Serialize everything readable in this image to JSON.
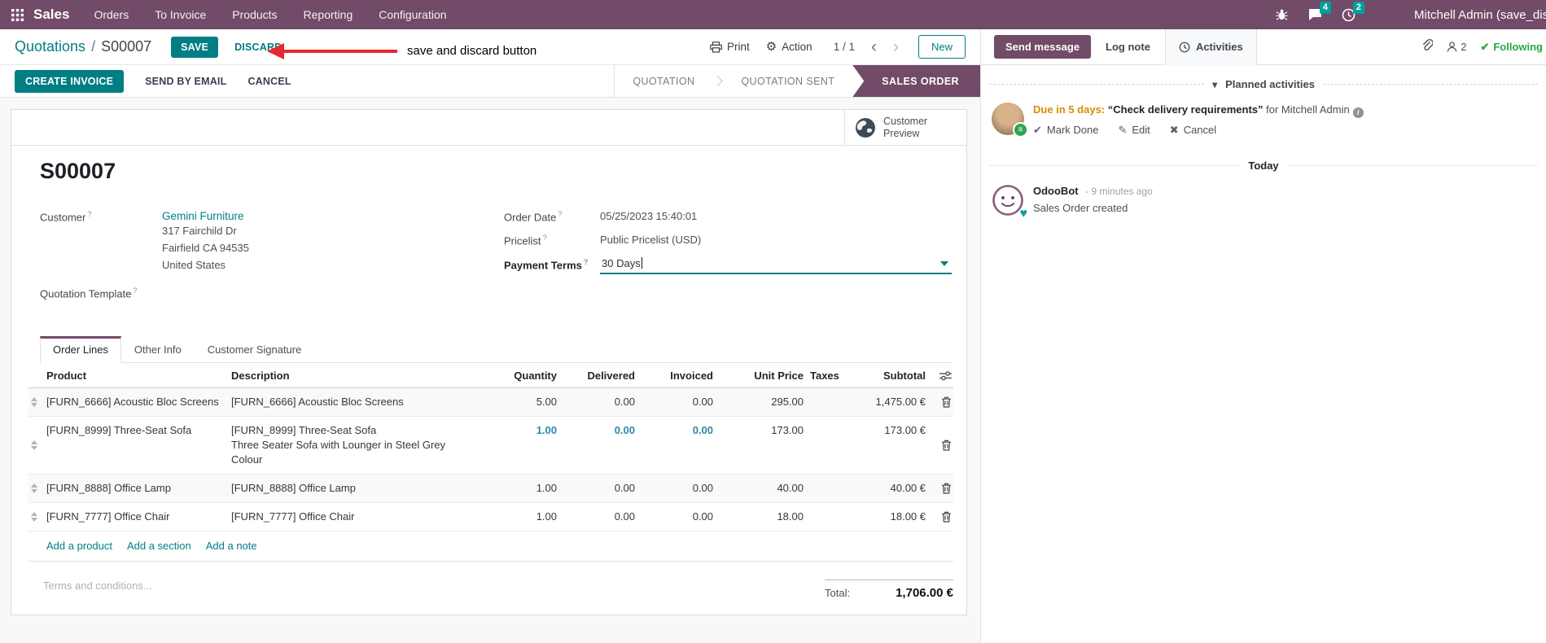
{
  "ui": {
    "help_marker": "?"
  },
  "colors": {
    "brand_purple": "#714B67",
    "accent_teal": "#017E84",
    "badge_teal": "#00A09D",
    "following_green": "#28a745",
    "due_orange": "#d78f00",
    "highlight_blue": "#2e86ab",
    "annotation_red": "#e8282f"
  },
  "nav": {
    "app": "Sales",
    "menus": [
      "Orders",
      "To Invoice",
      "Products",
      "Reporting",
      "Configuration"
    ],
    "messages_count": "4",
    "activities_count": "2",
    "user": "Mitchell Admin (save_discar"
  },
  "control": {
    "breadcrumb_parent": "Quotations",
    "breadcrumb_sep": "/",
    "breadcrumb_current": "S00007",
    "save_label": "SAVE",
    "discard_label": "DISCARD",
    "annotation": "save and discard button",
    "print_label": "Print",
    "action_label": "Action",
    "pager": "1 / 1",
    "pager_prev": "‹",
    "pager_next": "›",
    "new_label": "New"
  },
  "statusbar": {
    "action_buttons": [
      "CREATE INVOICE",
      "SEND BY EMAIL",
      "CANCEL"
    ],
    "stages": [
      "QUOTATION",
      "QUOTATION SENT",
      "SALES ORDER"
    ],
    "active_stage": "SALES ORDER"
  },
  "sheet": {
    "preview_button": "Customer Preview",
    "title": "S00007",
    "customer_label": "Customer",
    "customer_name": "Gemini Furniture",
    "address": [
      "317 Fairchild Dr",
      "Fairfield CA 94535",
      "United States"
    ],
    "template_label": "Quotation Template",
    "order_date_label": "Order Date",
    "order_date": "05/25/2023 15:40:01",
    "pricelist_label": "Pricelist",
    "pricelist": "Public Pricelist (USD)",
    "payment_terms_label": "Payment Terms",
    "payment_terms": "30 Days",
    "tabs": [
      "Order Lines",
      "Other Info",
      "Customer Signature"
    ],
    "table": {
      "headers": [
        "Product",
        "Description",
        "Quantity",
        "Delivered",
        "Invoiced",
        "Unit Price",
        "Taxes",
        "Subtotal"
      ],
      "rows": [
        {
          "product": "[FURN_6666] Acoustic Bloc Screens",
          "description": "[FURN_6666] Acoustic Bloc Screens",
          "description2": "",
          "quantity": "5.00",
          "delivered": "0.00",
          "invoiced": "0.00",
          "unit_price": "295.00",
          "taxes": "",
          "subtotal": "1,475.00 €",
          "highlight": false
        },
        {
          "product": "[FURN_8999] Three-Seat Sofa",
          "description": "[FURN_8999] Three-Seat Sofa",
          "description2": "Three Seater Sofa with Lounger in Steel Grey Colour",
          "quantity": "1.00",
          "delivered": "0.00",
          "invoiced": "0.00",
          "unit_price": "173.00",
          "taxes": "",
          "subtotal": "173.00 €",
          "highlight": true
        },
        {
          "product": "[FURN_8888] Office Lamp",
          "description": "[FURN_8888] Office Lamp",
          "description2": "",
          "quantity": "1.00",
          "delivered": "0.00",
          "invoiced": "0.00",
          "unit_price": "40.00",
          "taxes": "",
          "subtotal": "40.00 €",
          "highlight": false
        },
        {
          "product": "[FURN_7777] Office Chair",
          "description": "[FURN_7777] Office Chair",
          "description2": "",
          "quantity": "1.00",
          "delivered": "0.00",
          "invoiced": "0.00",
          "unit_price": "18.00",
          "taxes": "",
          "subtotal": "18.00 €",
          "highlight": false
        }
      ],
      "footer_links": [
        "Add a product",
        "Add a section",
        "Add a note"
      ]
    },
    "terms_placeholder": "Terms and conditions...",
    "total_label": "Total:",
    "total": "1,706.00 €"
  },
  "chatter": {
    "send_message": "Send message",
    "log_note": "Log note",
    "activities_tab": "Activities",
    "followers_count": "2",
    "following_label": "Following",
    "following_check": "✔",
    "collapse_caret": "▾",
    "planned_title": "Planned activities",
    "activity": {
      "due_label": "Due in 5 days:",
      "summary": "“Check delivery requirements”",
      "assignee": "for Mitchell Admin",
      "mark_done_icon": "✔",
      "mark_done_label": "Mark Done",
      "edit_icon": "✎",
      "edit_label": "Edit",
      "cancel_icon": "✖",
      "cancel_label": "Cancel"
    },
    "today_label": "Today",
    "message": {
      "author": "OdooBot",
      "time": "- 9 minutes ago",
      "body": "Sales Order created"
    }
  }
}
